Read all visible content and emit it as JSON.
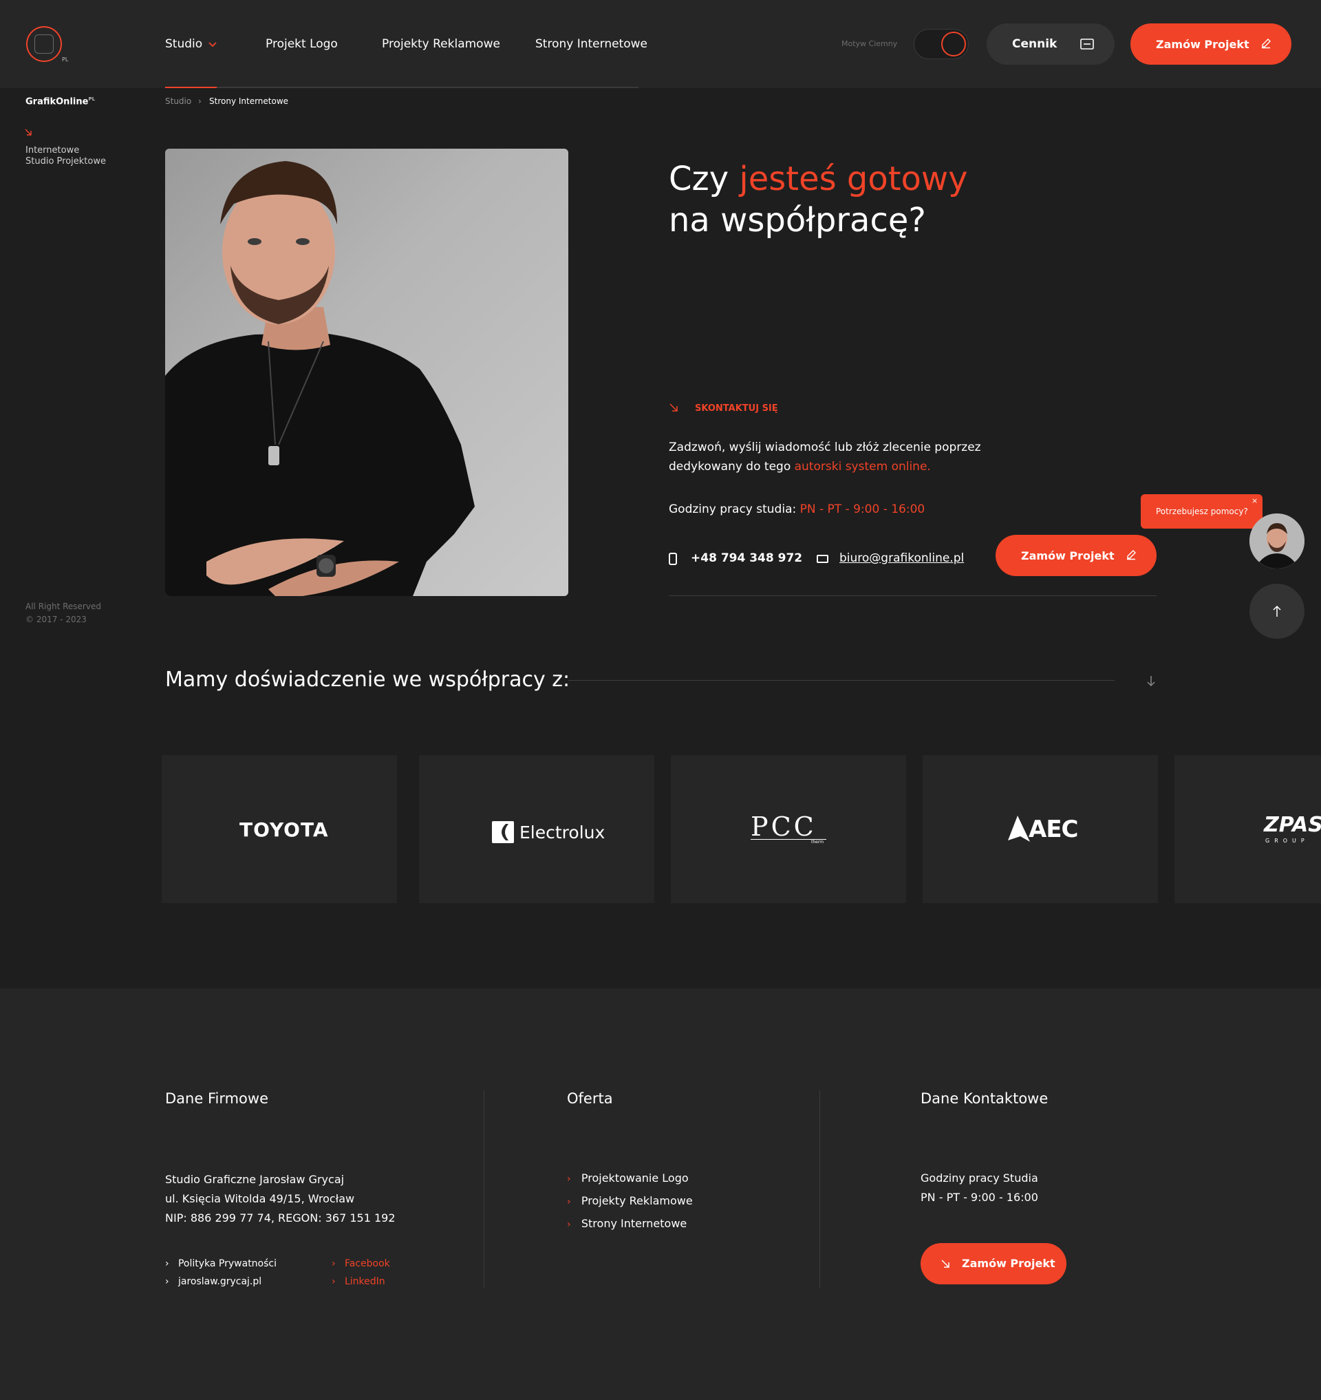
{
  "colors": {
    "accent": "#f04328",
    "background": "#1e1e1e",
    "panel": "#262626"
  },
  "header": {
    "logo_badge": "PL",
    "nav": [
      {
        "label": "Studio"
      },
      {
        "label": "Projekt Logo"
      },
      {
        "label": "Projekty Reklamowe"
      },
      {
        "label": "Strony Internetowe"
      }
    ],
    "theme_label": "Motyw Ciemny",
    "cennik_label": "Cennik",
    "zamow_label": "Zamów Projekt"
  },
  "sidebar": {
    "brand": "GrafikOnline",
    "brand_sup": "PL",
    "line1": "Internetowe",
    "line2": "Studio Projektowe",
    "rights": "All Right Reserved",
    "copyright": "© 2017 - 2023"
  },
  "breadcrumb": {
    "root": "Studio",
    "separator": "›",
    "current": "Strony Internetowe"
  },
  "hero": {
    "title_part1": "Czy ",
    "title_accent": "jesteś gotowy",
    "title_line2": "na współpracę?",
    "contact_label": "SKONTAKTUJ SIĘ",
    "para_line1": "Zadzwoń, wyślij wiadomość lub złóż zlecenie poprzez",
    "para_line2_prefix": "dedykowany do tego ",
    "para_line2_link": "autorski system online.",
    "hours_prefix": "Godziny pracy studia: ",
    "hours_value": "PN - PT - 9:00 - 16:00",
    "phone": "+48 794 348 972",
    "email": "biuro@grafikonline.pl",
    "zamow_label": "Zamów Projekt"
  },
  "help": {
    "text": "Potrzebujesz pomocy?",
    "close": "×"
  },
  "experience": {
    "title": "Mamy doświadczenie we współpracy z:",
    "logos": [
      "TOYOTA",
      "Electrolux",
      "PCC",
      "AEC",
      "ZPAS"
    ],
    "pcc_sub": "therm",
    "zpas_sub": "GROUP"
  },
  "footer": {
    "col1": {
      "heading": "Dane Firmowe",
      "line1": "Studio Graficzne Jarosław Grycaj",
      "line2": "ul. Księcia Witolda 49/15, Wrocław",
      "line3": "NIP: 886 299 77 74, REGON: 367 151 192",
      "links": [
        "Polityka Prywatności",
        "jaroslaw.grycaj.pl"
      ],
      "social": [
        "Facebook",
        "LinkedIn"
      ]
    },
    "col2": {
      "heading": "Oferta",
      "items": [
        "Projektowanie Logo",
        "Projekty Reklamowe",
        "Strony Internetowe"
      ]
    },
    "col3": {
      "heading": "Dane Kontaktowe",
      "hours_label": "Godziny pracy Studia",
      "hours_value": "PN - PT - 9:00 - 16:00",
      "zamow_label": "Zamów Projekt"
    }
  }
}
